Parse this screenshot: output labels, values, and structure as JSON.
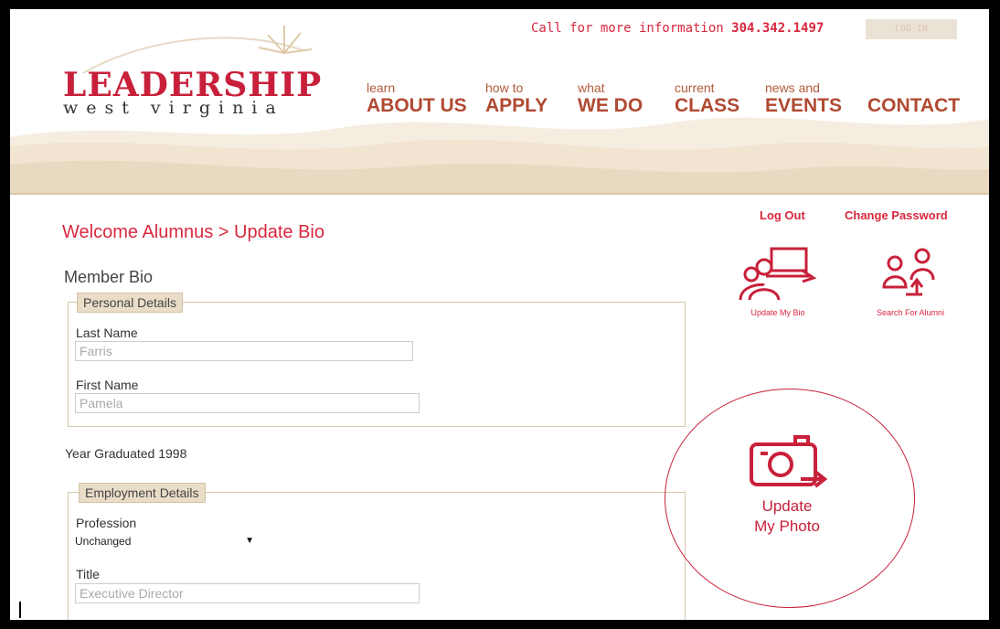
{
  "header": {
    "phone_prefix": "Call for more information",
    "phone_number": "304.342.1497",
    "login_label": "LOG-IN",
    "logo_word": "LEADERSHIP",
    "logo_sub": "west virginia"
  },
  "nav": [
    {
      "small": "learn",
      "big": "ABOUT US"
    },
    {
      "small": "how to",
      "big": "APPLY"
    },
    {
      "small": "what",
      "big": "WE DO"
    },
    {
      "small": "current",
      "big": "CLASS"
    },
    {
      "small": "news and",
      "big": "EVENTS"
    },
    {
      "small": "",
      "big": "CONTACT"
    }
  ],
  "page": {
    "title": "Welcome Alumnus > Update Bio",
    "section_title": "Member Bio"
  },
  "links": {
    "logout": "Log Out",
    "change_password": "Change Password",
    "update_bio": "Update My Bio",
    "search_alumni": "Search For Alumni",
    "update_photo_line1": "Update",
    "update_photo_line2": "My Photo"
  },
  "personal": {
    "legend": "Personal Details",
    "last_name_label": "Last Name",
    "last_name_value": "Farris",
    "first_name_label": "First Name",
    "first_name_value": "Pamela"
  },
  "year_graduated": "Year Graduated 1998",
  "employment": {
    "legend": "Employment Details",
    "profession_label": "Profession",
    "profession_value": "Unchanged",
    "title_label": "Title",
    "title_value": "Executive Director"
  },
  "colors": {
    "brand_red": "#c8203a",
    "accent_red": "#d8283f",
    "hill_beige": "#efdfc8"
  }
}
